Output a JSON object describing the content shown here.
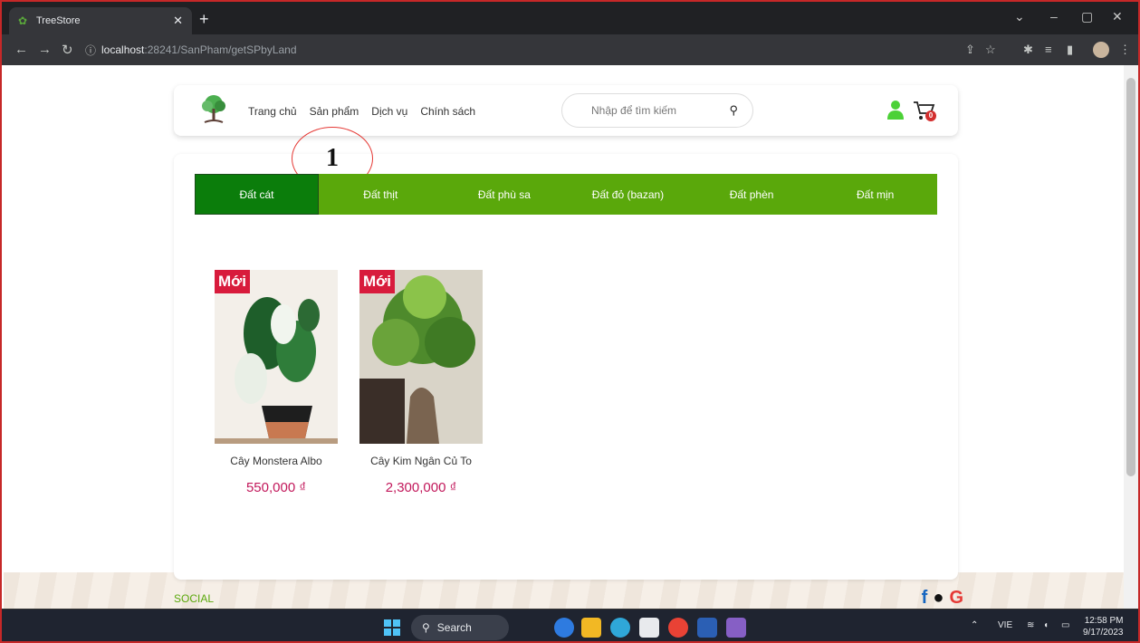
{
  "browser": {
    "tab_title": "TreeStore",
    "url_host": "localhost",
    "url_path": ":28241/SanPham/getSPbyLand"
  },
  "header": {
    "nav": [
      "Trang chủ",
      "Sản phẩm",
      "Dịch vụ",
      "Chính sách"
    ],
    "search_placeholder": "Nhập để tìm kiếm",
    "cart_count": "0"
  },
  "annotation": {
    "label": "1"
  },
  "categories": [
    {
      "label": "Đất cát",
      "active": true
    },
    {
      "label": "Đất thịt",
      "active": false
    },
    {
      "label": "Đất phù sa",
      "active": false
    },
    {
      "label": "Đất đỏ (bazan)",
      "active": false
    },
    {
      "label": "Đất phèn",
      "active": false
    },
    {
      "label": "Đất mịn",
      "active": false
    }
  ],
  "products": [
    {
      "badge": "Mới",
      "name": "Cây Monstera Albo",
      "price": "550,000 ₫"
    },
    {
      "badge": "Mới",
      "name": "Cây Kim Ngân Củ To",
      "price": "2,300,000 ₫"
    }
  ],
  "footer": {
    "social_label": "SOCIAL"
  },
  "taskbar": {
    "search_label": "Search",
    "lang": "VIE",
    "time": "12:58 PM",
    "date": "9/17/2023"
  }
}
